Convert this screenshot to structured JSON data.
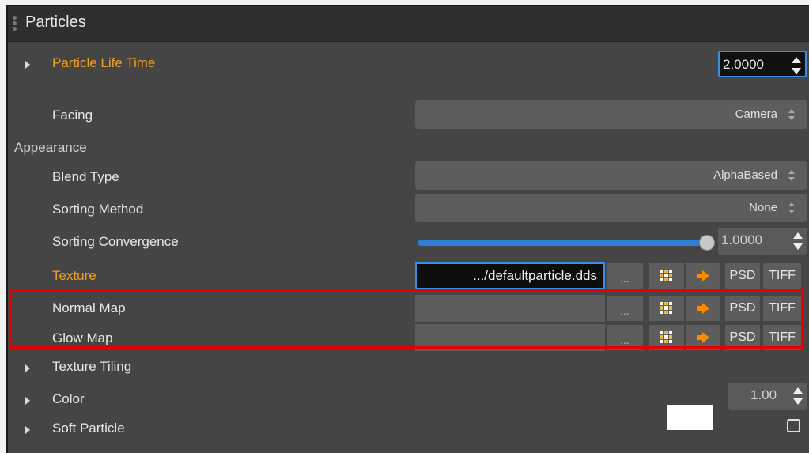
{
  "panel": {
    "title": "Particles"
  },
  "properties": {
    "particle_life_time": {
      "label": "Particle Life Time",
      "value": "2.0000"
    },
    "facing": {
      "label": "Facing",
      "value": "Camera"
    },
    "appearance_label": "Appearance",
    "blend_type": {
      "label": "Blend Type",
      "value": "AlphaBased"
    },
    "sorting_method": {
      "label": "Sorting Method",
      "value": "None"
    },
    "sorting_convergence": {
      "label": "Sorting Convergence",
      "value": "1.0000",
      "slider_fraction": 1.0
    },
    "texture": {
      "label": "Texture",
      "value": ".../defaultparticle.dds"
    },
    "normal_map": {
      "label": "Normal Map",
      "value": ""
    },
    "glow_map": {
      "label": "Glow Map",
      "value": ""
    },
    "texture_tiling": {
      "label": "Texture Tiling"
    },
    "color": {
      "label": "Color",
      "swatch": "#ffffff",
      "value": "1.00"
    },
    "soft_particle": {
      "label": "Soft Particle",
      "checked": false
    }
  },
  "buttons": {
    "browse": "...",
    "psd": "PSD",
    "tiff": "TIFF"
  },
  "icons": {
    "expander": "triangle-right-icon",
    "thumbnail": "grid-thumbnail-icon",
    "apply": "orange-arrow-icon"
  },
  "colors": {
    "accent_orange": "#f0a020",
    "focus_blue": "#3a8de0",
    "highlight_red": "#e80000"
  }
}
